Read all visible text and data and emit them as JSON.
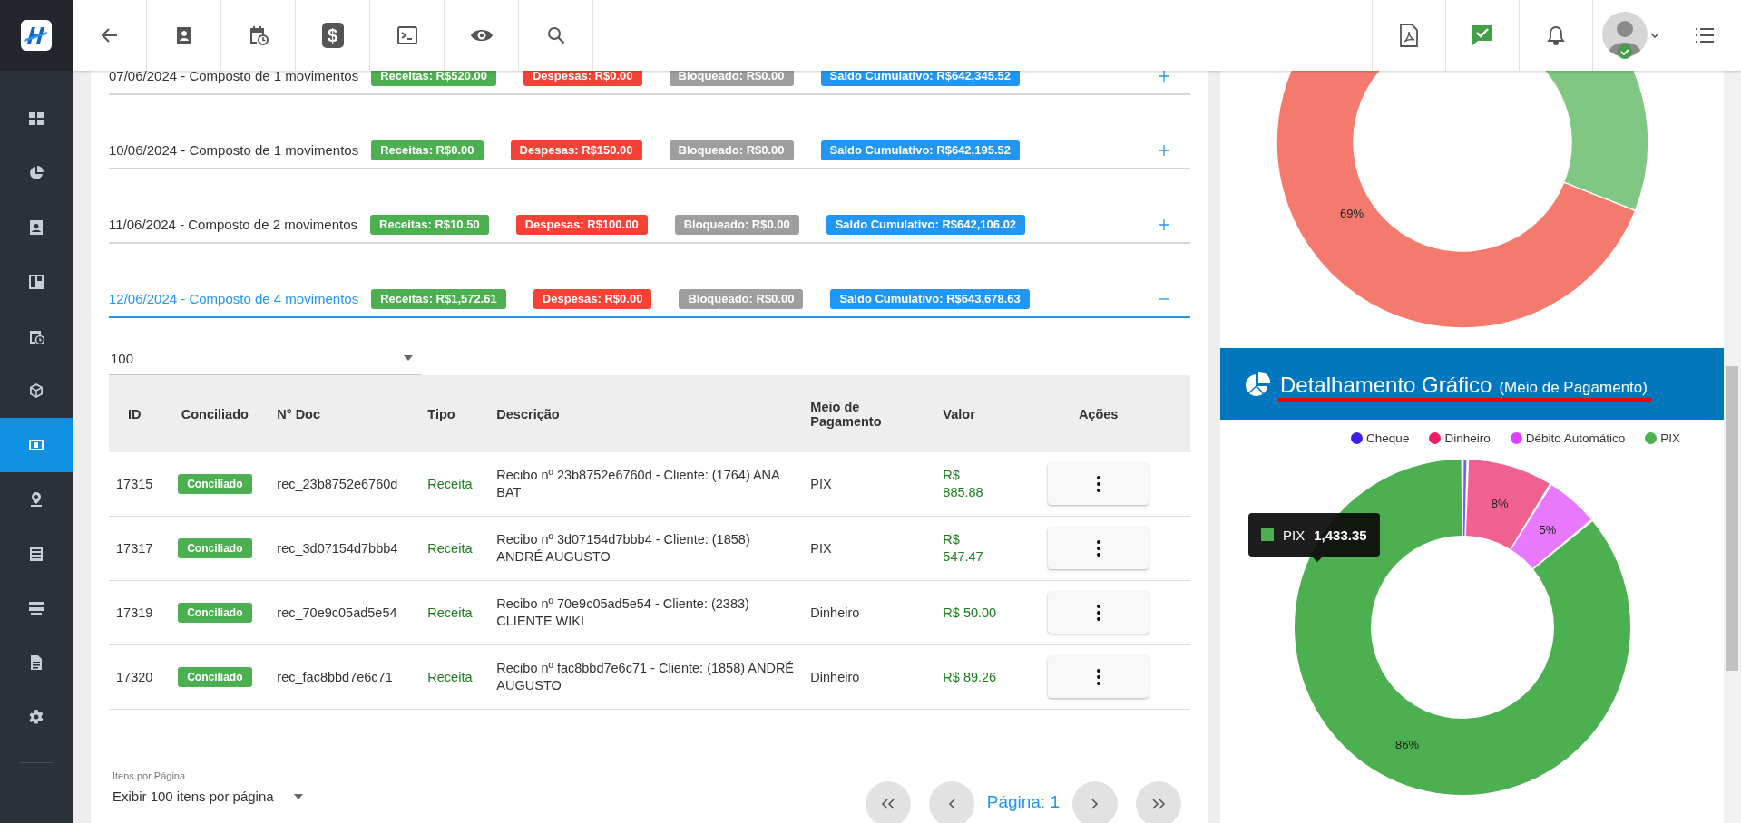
{
  "sidebar": {
    "items": [
      {
        "kind": "grid",
        "selected": false
      },
      {
        "kind": "pie",
        "selected": false
      },
      {
        "kind": "contact",
        "selected": false
      },
      {
        "kind": "board",
        "selected": false
      },
      {
        "kind": "calendar",
        "selected": false
      },
      {
        "kind": "box",
        "selected": false
      },
      {
        "kind": "money",
        "selected": true
      },
      {
        "kind": "pin",
        "selected": false
      },
      {
        "kind": "list",
        "selected": false
      },
      {
        "kind": "server",
        "selected": false
      },
      {
        "kind": "document",
        "selected": false
      },
      {
        "kind": "gear",
        "selected": false
      }
    ]
  },
  "toolbar": [
    {
      "kind": "back"
    },
    {
      "kind": "contact"
    },
    {
      "kind": "calendar"
    },
    {
      "kind": "money",
      "glyph": "$"
    },
    {
      "kind": "terminal"
    },
    {
      "kind": "eye"
    },
    {
      "kind": "search"
    }
  ],
  "toolbar_right": [
    {
      "kind": "pdf"
    },
    {
      "kind": "check"
    },
    {
      "kind": "bell"
    },
    {
      "kind": "avatar"
    },
    {
      "kind": "menu"
    }
  ],
  "groups": [
    {
      "title": "07/06/2024 - Composto de 1 movimentos",
      "expanded": false,
      "tags": [
        {
          "kind": "receitas",
          "text": "Receitas: R$520.00"
        },
        {
          "kind": "despesas",
          "text": "Despesas: R$0.00"
        },
        {
          "kind": "bloqueado",
          "text": "Bloqueado: R$0.00"
        },
        {
          "kind": "saldo",
          "text": "Saldo Cumulativo: R$642,345.52"
        }
      ]
    },
    {
      "title": "10/06/2024 - Composto de 1 movimentos",
      "expanded": false,
      "tags": [
        {
          "kind": "receitas",
          "text": "Receitas: R$0.00"
        },
        {
          "kind": "despesas",
          "text": "Despesas: R$150.00"
        },
        {
          "kind": "bloqueado",
          "text": "Bloqueado: R$0.00"
        },
        {
          "kind": "saldo",
          "text": "Saldo Cumulativo: R$642,195.52"
        }
      ]
    },
    {
      "title": "11/06/2024 - Composto de 2 movimentos",
      "expanded": false,
      "tags": [
        {
          "kind": "receitas",
          "text": "Receitas: R$10.50"
        },
        {
          "kind": "despesas",
          "text": "Despesas: R$100.00"
        },
        {
          "kind": "bloqueado",
          "text": "Bloqueado: R$0.00"
        },
        {
          "kind": "saldo",
          "text": "Saldo Cumulativo: R$642,106.02"
        }
      ]
    },
    {
      "title": "12/06/2024 - Composto de 4 movimentos",
      "expanded": true,
      "tags": [
        {
          "kind": "receitas",
          "text": "Receitas: R$1,572.61"
        },
        {
          "kind": "despesas",
          "text": "Despesas: R$0.00"
        },
        {
          "kind": "bloqueado",
          "text": "Bloqueado: R$0.00"
        },
        {
          "kind": "saldo",
          "text": "Saldo Cumulativo: R$643,678.63"
        }
      ]
    }
  ],
  "page_size_select": {
    "value": "100"
  },
  "table": {
    "columns": [
      "ID",
      "Conciliado",
      "N° Doc",
      "Tipo",
      "Descrição",
      "Meio de Pagamento",
      "Valor",
      "Ações"
    ],
    "rows": [
      {
        "id": "17315",
        "status": "Conciliado",
        "doc": "rec_23b8752e6760d",
        "tipo": "Receita",
        "descricao": "Recibo nº 23b8752e6760d - Cliente: (1764) ANA BAT",
        "meio": "PIX",
        "valor": "R$ 885.88"
      },
      {
        "id": "17317",
        "status": "Conciliado",
        "doc": "rec_3d07154d7bbb4",
        "tipo": "Receita",
        "descricao": "Recibo nº 3d07154d7bbb4 - Cliente: (1858) ANDRÉ AUGUSTO",
        "meio": "PIX",
        "valor": "R$ 547.47"
      },
      {
        "id": "17319",
        "status": "Conciliado",
        "doc": "rec_70e9c05ad5e54",
        "tipo": "Receita",
        "descricao": "Recibo nº 70e9c05ad5e54 - Cliente: (2383) CLIENTE WIKI",
        "meio": "Dinheiro",
        "valor": "R$ 50.00"
      },
      {
        "id": "17320",
        "status": "Conciliado",
        "doc": "rec_fac8bbd7e6c71",
        "tipo": "Receita",
        "descricao": "Recibo nº fac8bbd7e6c71 - Cliente: (1858) ANDRÉ AUGUSTO",
        "meio": "Dinheiro",
        "valor": "R$ 89.26"
      }
    ]
  },
  "items_per_page": {
    "label": "Itens por Página",
    "value": "Exibir 100 itens por página"
  },
  "pagination": {
    "page_label": "Página: 1"
  },
  "top_chart": {
    "label": "69%"
  },
  "chart_panel": {
    "title": "Detalhamento Gráfico",
    "subtitle": "(Meio de Pagamento)",
    "legend": [
      {
        "color": "#3d1de8",
        "hovered": false
      },
      {
        "color": "#e91e63",
        "hovered": false
      },
      {
        "color": "#e040fb",
        "hovered": false
      },
      {
        "color": "#4caf50",
        "hovered": true
      }
    ],
    "chart_data": {
      "type": "donut",
      "categories": [
        "Cheque",
        "Dinheiro",
        "Débito Automático",
        "PIX"
      ],
      "series": [
        {
          "values": [
            0.5,
            8.3,
            5.2,
            86
          ]
        }
      ],
      "value_labels": [
        null,
        "8%",
        "5%",
        "86%"
      ]
    },
    "tooltip": {
      "label": "PIX",
      "value": "1,433.35"
    }
  }
}
